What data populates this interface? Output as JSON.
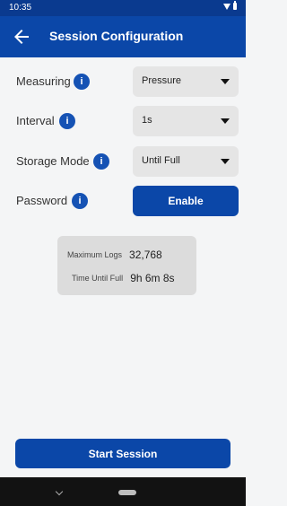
{
  "status_bar": {
    "time": "10:35",
    "icons": [
      "wifi-icon",
      "battery-icon"
    ]
  },
  "app_bar": {
    "title": "Session Configuration",
    "back_icon": "back-arrow-icon"
  },
  "settings": {
    "measuring": {
      "label": "Measuring",
      "value": "Pressure"
    },
    "interval": {
      "label": "Interval",
      "value": "1s"
    },
    "storage_mode": {
      "label": "Storage Mode",
      "value": "Until Full"
    },
    "password": {
      "label": "Password",
      "button_label": "Enable"
    }
  },
  "info_glyph": "i",
  "summary": {
    "max_logs_label": "Maximum Logs",
    "max_logs_value": "32,768",
    "time_until_full_label": "Time Until Full",
    "time_until_full_value": "9h 6m 8s"
  },
  "actions": {
    "start_label": "Start Session"
  },
  "colors": {
    "primary": "#0b47a8",
    "status_bar": "#0a3a8f",
    "field_bg": "#e5e5e5",
    "panel_bg": "#dcdcdc"
  }
}
